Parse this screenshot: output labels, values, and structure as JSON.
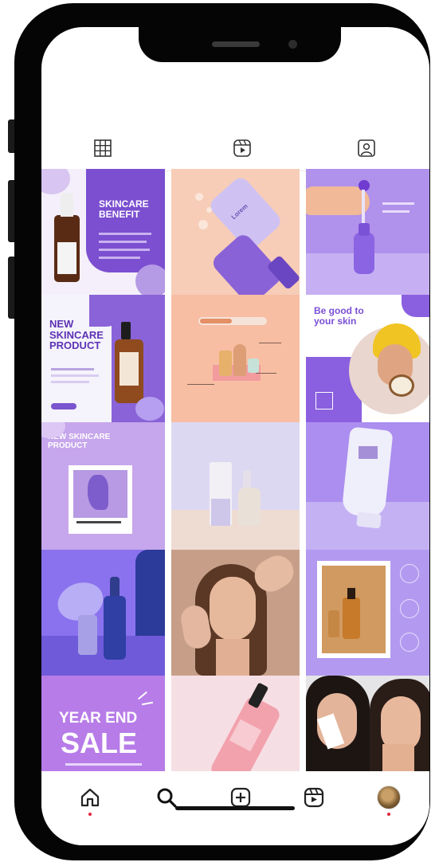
{
  "profile_tabs": [
    {
      "name": "grid"
    },
    {
      "name": "reels"
    },
    {
      "name": "tagged"
    }
  ],
  "posts": {
    "p1": {
      "title": "SKINCARE BENEFIT"
    },
    "p2": {
      "bottle_label": "Lorem"
    },
    "p4": {
      "title": "NEW SKINCARE PRODUCT"
    },
    "p6": {
      "title": "Be good to your skin"
    },
    "p7": {
      "title": "NEW SKINCARE PRODUCT"
    },
    "p13": {
      "line1": "YEAR END",
      "line2": "SALE"
    }
  },
  "bottom_nav": [
    "home",
    "search",
    "create",
    "reels",
    "profile"
  ],
  "colors": {
    "accent_purple": "#8a5cd6",
    "light_purple": "#c6a8ee",
    "peach": "#f7c2a6",
    "notification_red": "#e3243b"
  }
}
